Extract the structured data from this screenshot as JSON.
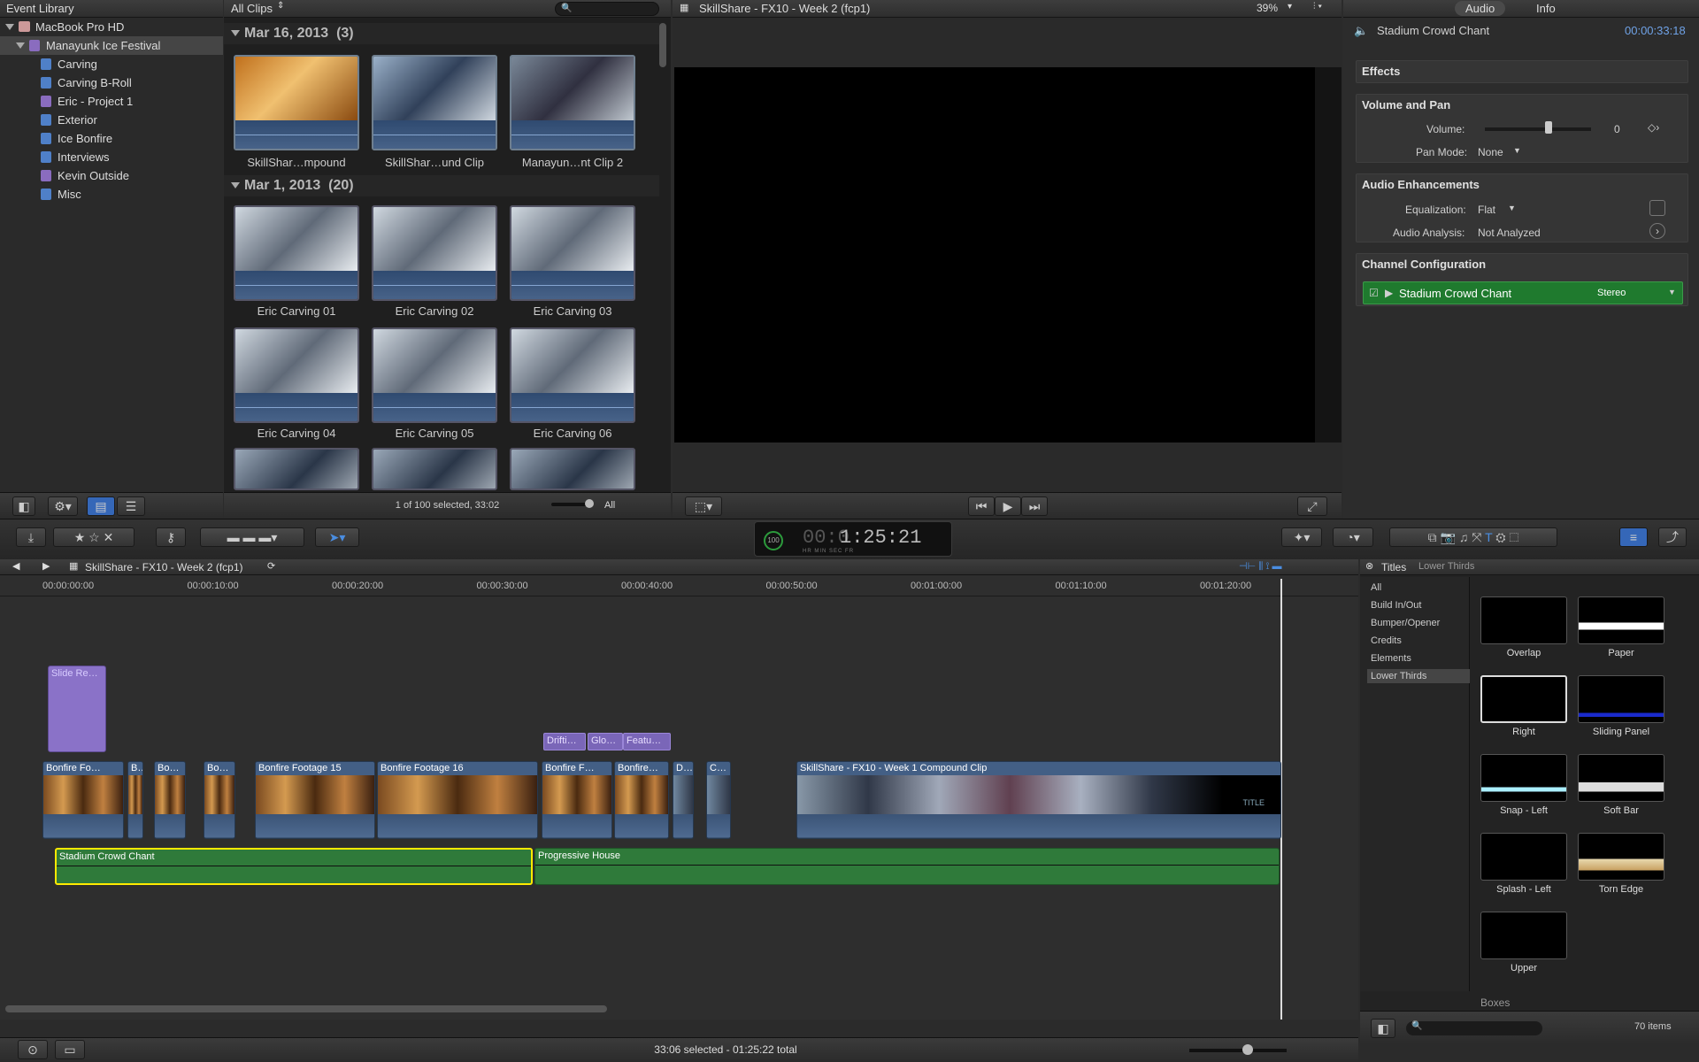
{
  "library": {
    "title": "Event Library",
    "disk": "MacBook Pro HD",
    "event": "Manayunk Ice Festival",
    "items": [
      {
        "label": "Carving",
        "type": "blue"
      },
      {
        "label": "Carving B-Roll",
        "type": "blue"
      },
      {
        "label": "Eric - Project 1",
        "type": "purple"
      },
      {
        "label": "Exterior",
        "type": "blue"
      },
      {
        "label": "Ice Bonfire",
        "type": "blue"
      },
      {
        "label": "Interviews",
        "type": "blue"
      },
      {
        "label": "Kevin Outside",
        "type": "purple"
      },
      {
        "label": "Misc",
        "type": "blue"
      }
    ]
  },
  "browser": {
    "filter": "All Clips",
    "groups": [
      {
        "date": "Mar 16, 2013",
        "count": "(3)",
        "clips": [
          "SkillShar…mpound",
          "SkillShar…und Clip",
          "Manayun…nt Clip 2"
        ]
      },
      {
        "date": "Mar 1, 2013",
        "count": "(20)",
        "clips": [
          "Eric Carving 01",
          "Eric Carving 02",
          "Eric Carving 03",
          "Eric Carving 04",
          "Eric Carving 05",
          "Eric Carving 06"
        ]
      }
    ],
    "status": "1 of 100 selected, 33:02",
    "show": "All"
  },
  "viewer": {
    "title": "SkillShare - FX10 - Week 2 (fcp1)",
    "zoom": "39%"
  },
  "inspector": {
    "tabs": [
      "Audio",
      "Info"
    ],
    "clip_name": "Stadium Crowd Chant",
    "duration": "00:00:33:18",
    "effects": "Effects",
    "volpan": "Volume and Pan",
    "volume_label": "Volume:",
    "volume_value": "0",
    "pan_label": "Pan Mode:",
    "pan_value": "None",
    "enh": "Audio Enhancements",
    "eq_label": "Equalization:",
    "eq_value": "Flat",
    "aa_label": "Audio Analysis:",
    "aa_value": "Not Analyzed",
    "chan": "Channel Configuration",
    "chan_clip": "Stadium Crowd Chant",
    "chan_mode": "Stereo"
  },
  "toolbar": {
    "timecode": "1:25:21",
    "tc_prefix": "00:0",
    "tc_units": [
      "HR",
      "MIN",
      "SEC",
      "FR"
    ],
    "percent": "100"
  },
  "timeline": {
    "project": "SkillShare - FX10 - Week 2 (fcp1)",
    "ruler": [
      "00:00:00:00",
      "00:00:10:00",
      "00:00:20:00",
      "00:00:30:00",
      "00:00:40:00",
      "00:00:50:00",
      "00:01:00:00",
      "00:01:10:00",
      "00:01:20:00"
    ],
    "title_clip": "Slide Re…",
    "connected": [
      "Drifti…",
      "Glo…",
      "Featu…"
    ],
    "clips": [
      "Bonfire Fo…",
      "B…",
      "Bo…",
      "Bo…",
      "Bonfire Footage 15",
      "Bonfire Footage 16",
      "Bonfire F…",
      "Bonfire…",
      "D…",
      "C…",
      "SkillShare - FX10 - Week 1 Compound Clip"
    ],
    "title_thumb": "TITLE",
    "audio": [
      "Stadium Crowd Chant",
      "Progressive House"
    ],
    "status": "33:06 selected - 01:25:22 total"
  },
  "titles": {
    "header": "Titles",
    "sub": "Lower Thirds",
    "categories": [
      "All",
      "Build In/Out",
      "Bumper/Opener",
      "Credits",
      "Elements",
      "Lower Thirds"
    ],
    "items": [
      "Overlap",
      "Paper",
      "Right",
      "Sliding Panel",
      "Snap - Left",
      "Soft Bar",
      "Splash - Left",
      "Torn Edge",
      "Upper"
    ],
    "next_group": "Boxes",
    "count": "70 items"
  }
}
